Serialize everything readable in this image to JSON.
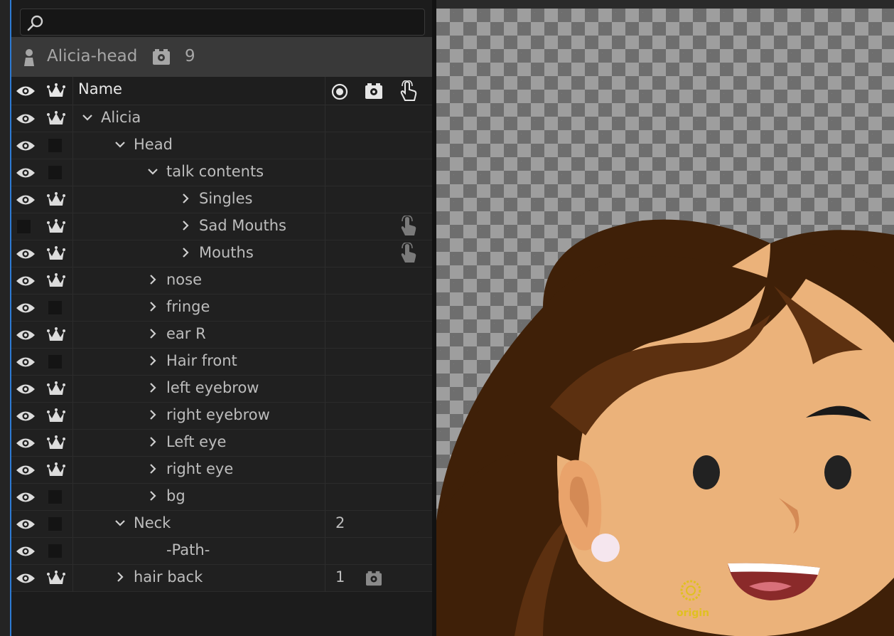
{
  "search": {
    "placeholder": "",
    "value": ""
  },
  "puppet": {
    "name": "Alicia-head",
    "count": "9"
  },
  "header": {
    "name_label": "Name"
  },
  "rows": [
    {
      "label": "Alicia",
      "visible": true,
      "crown": true,
      "expanded": true,
      "depth": 0,
      "number": "",
      "handle": false,
      "puppet": false
    },
    {
      "label": "Head",
      "visible": true,
      "crown": false,
      "expanded": true,
      "depth": 1,
      "number": "",
      "handle": false,
      "puppet": false
    },
    {
      "label": "talk contents",
      "visible": true,
      "crown": false,
      "expanded": true,
      "depth": 2,
      "number": "",
      "handle": false,
      "puppet": false
    },
    {
      "label": "Singles",
      "visible": true,
      "crown": true,
      "expanded": false,
      "depth": 3,
      "number": "",
      "handle": false,
      "puppet": false
    },
    {
      "label": "Sad Mouths",
      "visible": false,
      "crown": true,
      "expanded": false,
      "depth": 3,
      "number": "",
      "handle": true,
      "puppet": false
    },
    {
      "label": "Mouths",
      "visible": true,
      "crown": true,
      "expanded": false,
      "depth": 3,
      "number": "",
      "handle": true,
      "puppet": false
    },
    {
      "label": "nose",
      "visible": true,
      "crown": true,
      "expanded": false,
      "depth": 2,
      "number": "",
      "handle": false,
      "puppet": false
    },
    {
      "label": "fringe",
      "visible": true,
      "crown": false,
      "expanded": false,
      "depth": 2,
      "number": "",
      "handle": false,
      "puppet": false
    },
    {
      "label": "ear R",
      "visible": true,
      "crown": true,
      "expanded": false,
      "depth": 2,
      "number": "",
      "handle": false,
      "puppet": false
    },
    {
      "label": "Hair front",
      "visible": true,
      "crown": false,
      "expanded": false,
      "depth": 2,
      "number": "",
      "handle": false,
      "puppet": false
    },
    {
      "label": "left eyebrow",
      "visible": true,
      "crown": true,
      "expanded": false,
      "depth": 2,
      "number": "",
      "handle": false,
      "puppet": false
    },
    {
      "label": "right eyebrow",
      "visible": true,
      "crown": true,
      "expanded": false,
      "depth": 2,
      "number": "",
      "handle": false,
      "puppet": false
    },
    {
      "label": "Left eye",
      "visible": true,
      "crown": true,
      "expanded": false,
      "depth": 2,
      "number": "",
      "handle": false,
      "puppet": false
    },
    {
      "label": "right eye",
      "visible": true,
      "crown": true,
      "expanded": false,
      "depth": 2,
      "number": "",
      "handle": false,
      "puppet": false
    },
    {
      "label": "bg",
      "visible": true,
      "crown": false,
      "expanded": false,
      "depth": 2,
      "number": "",
      "handle": false,
      "puppet": false
    },
    {
      "label": "Neck",
      "visible": true,
      "crown": false,
      "expanded": true,
      "depth": 1,
      "number": "2",
      "handle": false,
      "puppet": false
    },
    {
      "label": "-Path-",
      "visible": true,
      "crown": false,
      "expanded": null,
      "depth": 2,
      "number": "",
      "handle": false,
      "puppet": false
    },
    {
      "label": "hair back",
      "visible": true,
      "crown": true,
      "expanded": false,
      "depth": 1,
      "number": "1",
      "handle": false,
      "puppet": true
    }
  ],
  "canvas": {
    "origin_label": "origin"
  },
  "colors": {
    "accent": "#2d7bd4",
    "hair": "#3f2008",
    "hair_highlight": "#5c3010",
    "skin": "#ebb27a",
    "origin": "#e0c020"
  }
}
